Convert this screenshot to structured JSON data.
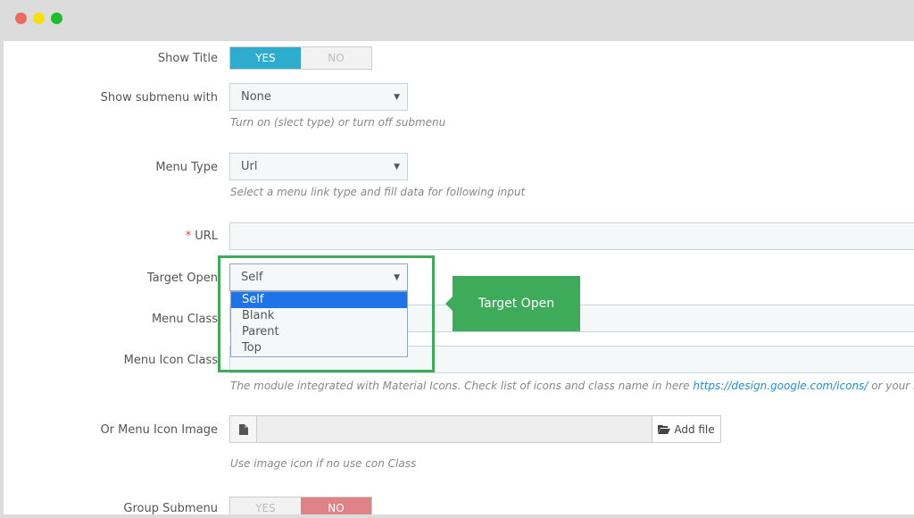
{
  "window": {
    "traffic_lights": [
      "#ec6a5e",
      "#f5e10a",
      "#1ebf2c"
    ]
  },
  "show_title": {
    "label": "Show Title",
    "yes": "YES",
    "no": "NO",
    "value": "YES"
  },
  "show_submenu": {
    "label": "Show submenu with",
    "value": "None",
    "help": "Turn on (slect type) or turn off submenu"
  },
  "menu_type": {
    "label": "Menu Type",
    "value": "Url",
    "help": "Select a menu link type and fill data for following input"
  },
  "url": {
    "required_mark": "*",
    "label": "URL",
    "value": ""
  },
  "target_open": {
    "label": "Target Open",
    "value": "Self",
    "options": [
      "Self",
      "Blank",
      "Parent",
      "Top"
    ],
    "selected_index": 0,
    "tooltip": "Target Open"
  },
  "menu_class": {
    "label": "Menu Class"
  },
  "menu_icon_class": {
    "label": "Menu Icon Class",
    "help_prefix": "The module integrated with Material Icons. Check list of icons and class name in here",
    "help_link": "https://design.google.com/icons/",
    "help_suffix": "or your icon class"
  },
  "menu_icon_image": {
    "label": "Or Menu Icon Image",
    "button": "Add file",
    "help": "Use image icon if no use con Class"
  },
  "group_submenu": {
    "label": "Group Submenu",
    "yes": "YES",
    "no": "NO",
    "value": "NO"
  },
  "colors": {
    "accent_blue": "#2eacce",
    "highlight_green": "#3eab5b",
    "no_red": "#e08386",
    "link_blue": "#1f8fd1"
  }
}
